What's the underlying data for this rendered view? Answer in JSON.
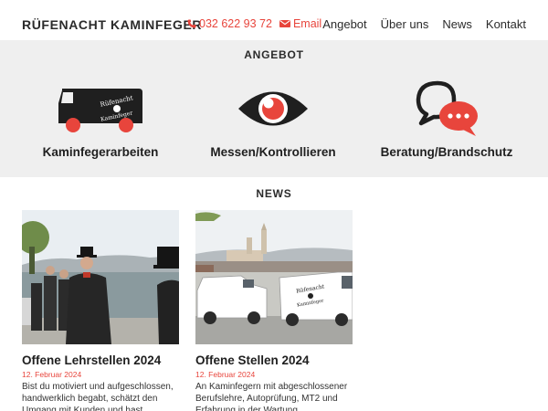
{
  "header": {
    "brand": "RÜFENACHT KAMINFEGER",
    "phone": "032 622 93 72",
    "email": "Email",
    "nav": [
      "Angebot",
      "Über uns",
      "News",
      "Kontakt"
    ]
  },
  "angebot": {
    "title": "ANGEBOT",
    "services": [
      {
        "label": "Kaminfegerarbeiten",
        "icon": "van-icon"
      },
      {
        "label": "Messen/Kontrollieren",
        "icon": "eye-icon"
      },
      {
        "label": "Beratung/Brandschutz",
        "icon": "chat-bubbles-icon"
      }
    ]
  },
  "news": {
    "title": "NEWS",
    "items": [
      {
        "title": "Offene Lehrstellen 2024",
        "date": "12. Februar 2024",
        "excerpt": "Bist du motiviert und aufgeschlossen, handwerklich begabt, schätzt den Umgang mit Kunden und hast"
      },
      {
        "title": "Offene Stellen 2024",
        "date": "12. Februar 2024",
        "excerpt": "An Kaminfegern mit abgeschlossener Berufslehre, Autoprüfung, MT2 und Erfahrung in der Wartung"
      }
    ]
  },
  "colors": {
    "accent": "#e8453c",
    "dark": "#2b2b2b",
    "band": "#efefef"
  }
}
